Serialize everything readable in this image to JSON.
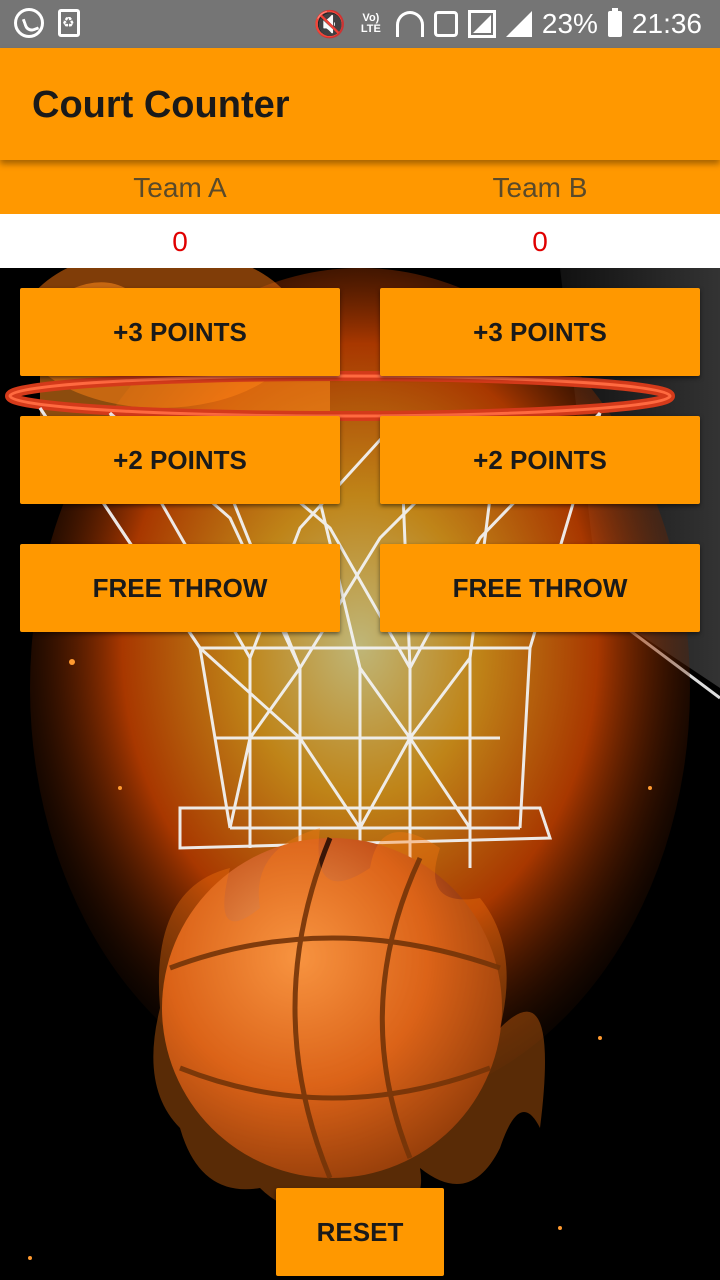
{
  "status_bar": {
    "battery_percent": "23%",
    "time": "21:36",
    "network_label": "LTE",
    "icons": [
      "whatsapp-icon",
      "recycle-icon",
      "mute-icon",
      "volte-icon",
      "wifi-icon",
      "rotation-icon",
      "signal-icon",
      "signal-icon",
      "battery-icon"
    ]
  },
  "app_bar": {
    "title": "Court Counter"
  },
  "teams": {
    "a": {
      "name": "Team A",
      "score": "0"
    },
    "b": {
      "name": "Team B",
      "score": "0"
    }
  },
  "buttons": {
    "three": "+3 POINTS",
    "two": "+2 POINTS",
    "free": "FREE THROW",
    "reset": "RESET"
  },
  "colors": {
    "accent": "#ff9800",
    "score": "#e00000",
    "status_bar": "#757575"
  }
}
